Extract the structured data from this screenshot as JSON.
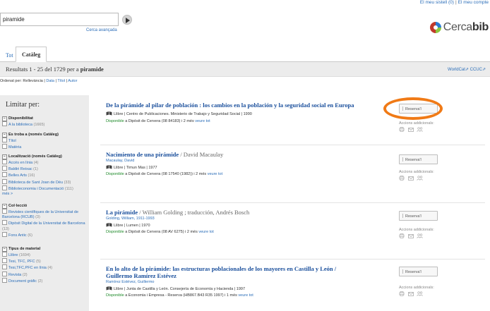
{
  "header": {
    "top_links": [
      "El meu sistell (0)",
      "El meu compte"
    ],
    "search_value": "piramide",
    "advanced_search": "Cerca avançada",
    "logo_text": "Cerca",
    "logo_bold": "bib"
  },
  "tabs": [
    {
      "label": "Tot",
      "active": false
    },
    {
      "label": "Catàleg",
      "active": true
    }
  ],
  "results_bar": {
    "prefix": "Resultats 1 - 25 del 1729 per a ",
    "query": "piramide",
    "external_links": [
      "WorldCat",
      "CCUC"
    ]
  },
  "sort": {
    "label": "Ordenat per:",
    "options": [
      "Rellevància",
      "Data",
      "Títol",
      "Autor"
    ]
  },
  "sidebar": {
    "title": "Limitar per:",
    "groups": [
      {
        "name": "Disponibilitat",
        "items": [
          {
            "label": "A la biblioteca",
            "count": "(1665)"
          }
        ]
      },
      {
        "name": "Es troba a (només Catàleg)",
        "items": [
          {
            "label": "Títol",
            "count": ""
          },
          {
            "label": "Matèria",
            "count": ""
          }
        ]
      },
      {
        "name": "Localització (només Catàleg)",
        "items": [
          {
            "label": "Accés en línia",
            "count": "(4)"
          },
          {
            "label": "Baldiri Reixac",
            "count": "(1)"
          },
          {
            "label": "Belles Arts",
            "count": "(16)"
          },
          {
            "label": "Biblioteca de Sant Joan de Déu",
            "count": "(33)"
          },
          {
            "label": "Biblioteconomia i Documentació",
            "count": "(111)"
          }
        ],
        "more": "més >"
      },
      {
        "name": "Col·lecció",
        "items": [
          {
            "label": "Revistes científiques de la Universitat de Barcelona (RCUB)",
            "count": "(3)"
          },
          {
            "label": "Dipòsit Digital de la Universitat de Barcelona",
            "count": "(13)"
          },
          {
            "label": "Fons Antic",
            "count": "(6)"
          }
        ]
      },
      {
        "name": "Tipus de material",
        "items": [
          {
            "label": "Llibre",
            "count": "(1694)"
          },
          {
            "label": "Tesi, TFC, PFC",
            "count": "(5)"
          },
          {
            "label": "Tesi,TFC,PFC en línia",
            "count": "(4)"
          },
          {
            "label": "Revista",
            "count": "(2)"
          },
          {
            "label": "Document gràfic",
            "count": "(2)"
          }
        ]
      }
    ]
  },
  "results": [
    {
      "title": "De la pirámide al pilar de población : los cambios en la población y la seguridad social en Europa",
      "responsibility": "",
      "author": "",
      "format": "Llibre",
      "publisher": "Centro de Publicaciones. Ministerio de Trabajo y Seguridad Social",
      "year": "1990",
      "availability_status": "Disponible",
      "availability_rest": " a Dipòsit de Cervera (08 84183) i 2 més",
      "view_all": "veure tot",
      "reserve": "Reserva'l",
      "more_actions": "Accions addicionals:"
    },
    {
      "title": "Nacimiento de una pirámide",
      "responsibility": " / David Macaulay",
      "author": "Macaulay, David",
      "format": "Llibre",
      "publisher": "Timun Mas",
      "year": "1977",
      "availability_status": "Disponible",
      "availability_rest": " a Dipòsit de Cervera (08 17540 (1982)) i 2 més",
      "view_all": "veure tot",
      "reserve": "Reserva'l",
      "more_actions": "Accions addicionals:"
    },
    {
      "title": "La pirámide",
      "responsibility": " / William Golding ; traducción, Andrés Bosch",
      "author": "Golding, William, 1911-1993",
      "format": "Llibre",
      "publisher": "Lumen",
      "year": "1970",
      "availability_status": "Disponible",
      "availability_rest": " a Dipòsit de Cervera (08 AV 6275) i 2 més",
      "view_all": "veure tot",
      "reserve": "Reserva'l",
      "more_actions": "Accions addicionals:"
    },
    {
      "title": "En lo alto de la pirámide: las estructuras poblacionales de los mayores en Castilla y León /",
      "title_line2": "Guillermo Ramírez Estévez",
      "responsibility": "",
      "author": "Ramírez Estévez, Guillermo",
      "format": "Llibre",
      "publisher": "Junta de Castilla y León. Consejería de Economía y Hacienda",
      "year": "1997",
      "availability_status": "Disponible",
      "availability_rest": " a Economia i Empresa - Reserva (HB867.B43 R35 1997) i 1 més",
      "view_all": "veure tot",
      "reserve": "Reserva'l",
      "more_actions": "Accions addicionals:"
    }
  ],
  "colors": {
    "link": "#2a6db8",
    "title": "#1a4f9c",
    "available": "#1f8a2a",
    "highlight": "#f07a16",
    "sidebar_bg": "#ececec"
  }
}
